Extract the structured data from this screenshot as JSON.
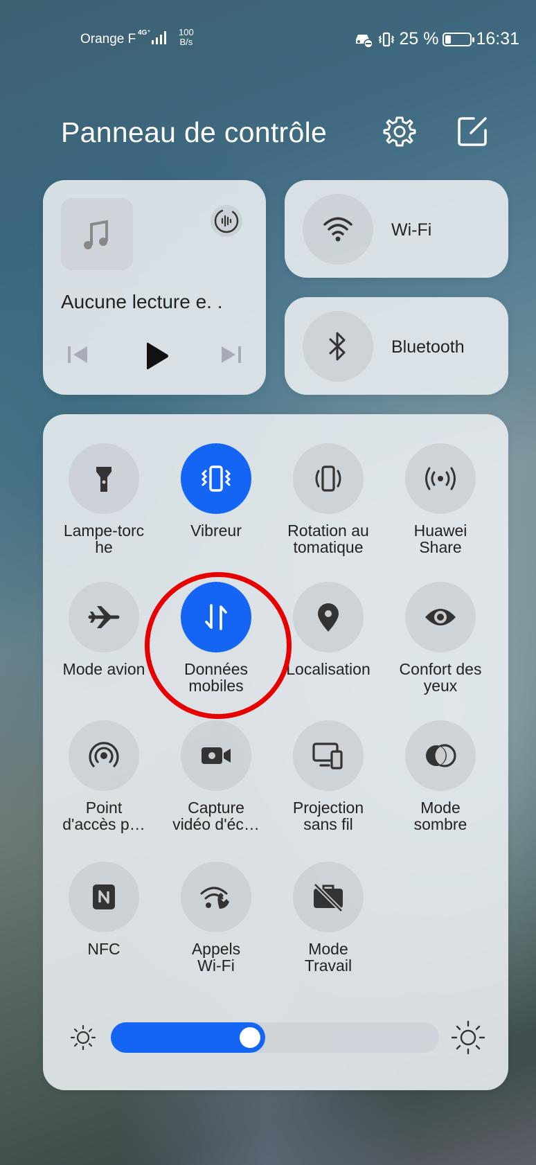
{
  "status_bar": {
    "carrier": "Orange F",
    "network_type": "4G⁺",
    "speed_value": "100",
    "speed_unit": "B/s",
    "battery_text": "25 %",
    "battery_level": 0.25,
    "time": "16:31"
  },
  "header": {
    "title": "Panneau de contrôle",
    "settings_icon": "gear-icon",
    "edit_icon": "edit-icon"
  },
  "media": {
    "title": "Aucune lecture e. .",
    "album_icon": "music-note-icon",
    "audio_icon": "audio-wave-icon"
  },
  "shortcuts": {
    "wifi": {
      "label": "Wi-Fi",
      "icon": "wifi-icon"
    },
    "bluetooth": {
      "label": "Bluetooth",
      "icon": "bluetooth-icon"
    }
  },
  "toggles": [
    {
      "label": [
        "Lampe-torc",
        "he"
      ],
      "icon": "flashlight-icon",
      "on": false
    },
    {
      "label": [
        "Vibreur"
      ],
      "icon": "vibrate-icon",
      "on": true
    },
    {
      "label": [
        "Rotation au",
        "tomatique"
      ],
      "icon": "auto-rotate-icon",
      "on": false
    },
    {
      "label": [
        "Huawei",
        "Share"
      ],
      "icon": "huawei-share-icon",
      "on": false
    },
    {
      "label": [
        "Mode avion"
      ],
      "icon": "airplane-icon",
      "on": false
    },
    {
      "label": [
        "Données",
        "mobiles"
      ],
      "icon": "mobile-data-icon",
      "on": true
    },
    {
      "label": [
        "Localisation"
      ],
      "icon": "location-icon",
      "on": false
    },
    {
      "label": [
        "Confort des",
        "yeux"
      ],
      "icon": "eye-comfort-icon",
      "on": false
    },
    {
      "label": [
        "Point",
        "d'accès p…"
      ],
      "icon": "hotspot-icon",
      "on": false
    },
    {
      "label": [
        "Capture",
        "vidéo d'éc…"
      ],
      "icon": "screen-record-icon",
      "on": false
    },
    {
      "label": [
        "Projection",
        "sans fil"
      ],
      "icon": "wireless-projection-icon",
      "on": false
    },
    {
      "label": [
        "Mode",
        "sombre"
      ],
      "icon": "dark-mode-icon",
      "on": false
    },
    {
      "label": [
        "NFC"
      ],
      "icon": "nfc-icon",
      "on": false
    },
    {
      "label": [
        "Appels",
        "Wi-Fi"
      ],
      "icon": "wifi-calling-icon",
      "on": false
    },
    {
      "label": [
        "Mode",
        "Travail"
      ],
      "icon": "work-mode-icon",
      "on": false
    }
  ],
  "brightness": {
    "level": 0.47,
    "low_icon": "brightness-low-icon",
    "high_icon": "brightness-high-icon"
  },
  "colors": {
    "accent": "#1565f5",
    "annotation": "#e60000"
  }
}
